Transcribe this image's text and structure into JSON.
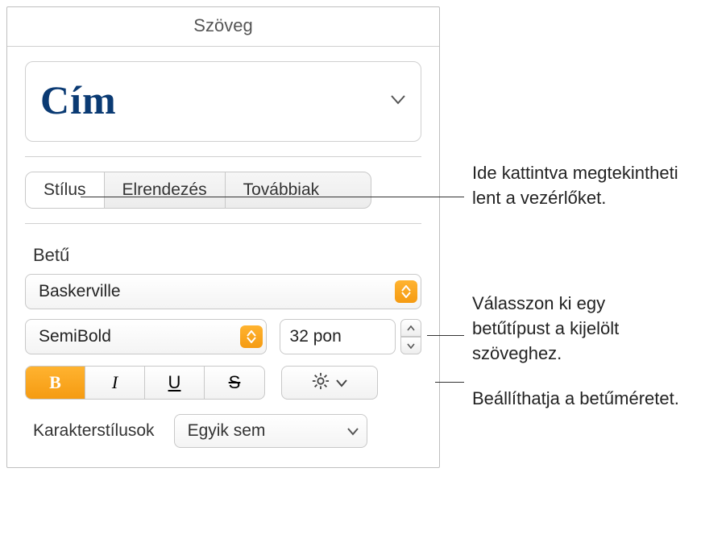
{
  "header": {
    "title": "Szöveg"
  },
  "paragraphStyle": {
    "name": "Cím"
  },
  "tabs": {
    "style": "Stílus",
    "layout": "Elrendezés",
    "more": "Továbbiak"
  },
  "font": {
    "section": "Betű",
    "family": "Baskerville",
    "typeface": "SemiBold",
    "size": "32 pon",
    "boldGlyph": "B",
    "italicGlyph": "I",
    "underlineGlyph": "U",
    "strikeGlyph": "S"
  },
  "characterStyles": {
    "label": "Karakterstílusok",
    "value": "Egyik sem"
  },
  "callouts": {
    "c1": "Ide kattintva megtekintheti lent a vezérlőket.",
    "c2": "Válasszon ki egy betűtípust a kijelölt szöveghez.",
    "c3": "Beállíthatja a betűméretet."
  }
}
